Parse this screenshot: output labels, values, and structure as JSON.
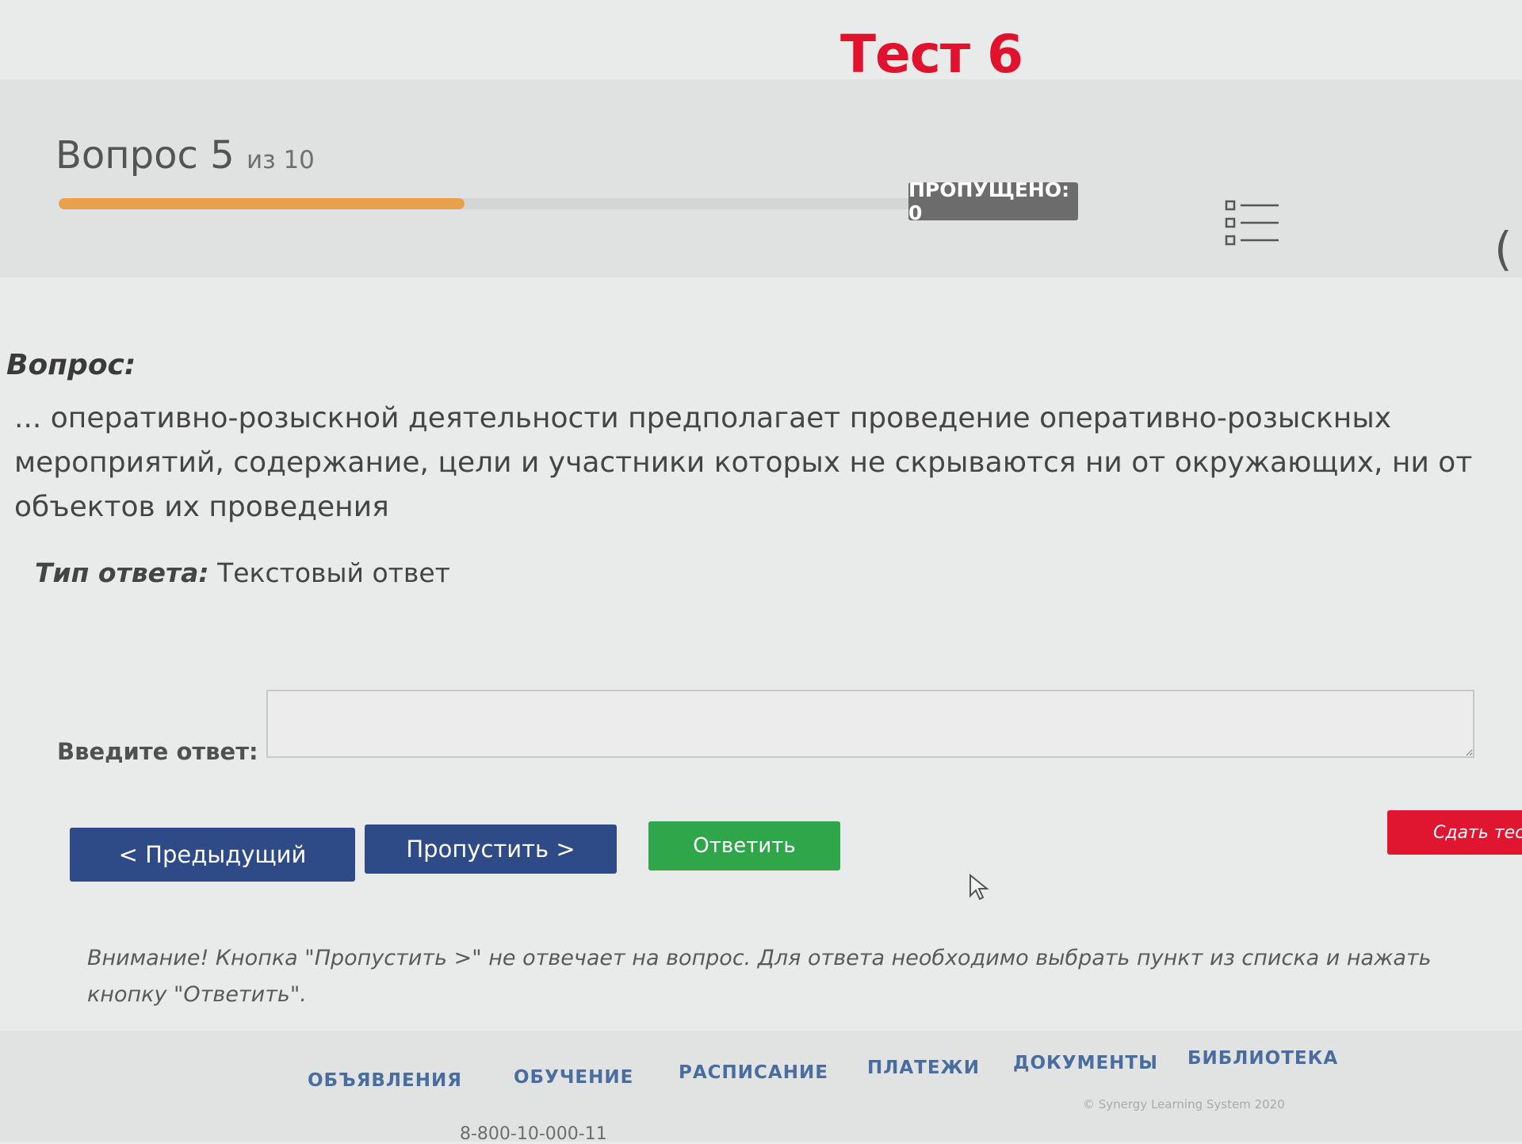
{
  "page": {
    "title": "Тест 6"
  },
  "progress": {
    "question_label": "Вопрос 5",
    "of_label": "из 10",
    "current": 5,
    "total": 10,
    "fill_fraction": 0.4,
    "skipped_label": "ПРОПУЩЕНО: 0"
  },
  "question": {
    "label": "Вопрос:",
    "text": "... оперативно-розыскной деятельности предполагает проведение оперативно-розыскных мероприятий, содержание, цели и участники которых не скрываются ни от окружающих, ни от объектов их проведения"
  },
  "answer_type": {
    "label": "Тип ответа:",
    "value": "Текстовый ответ"
  },
  "answer": {
    "label": "Введите ответ:",
    "value": ""
  },
  "buttons": {
    "prev": "< Предыдущий",
    "skip": "Пропустить >",
    "answer": "Ответить",
    "finish": "Сдать тест"
  },
  "warning": "Внимание! Кнопка \"Пропустить >\" не отвечает на вопрос. Для ответа необходимо выбрать пункт из списка и нажать кнопку \"Ответить\".",
  "footer": {
    "nav": [
      "ОБЪЯВЛЕНИЯ",
      "ОБУЧЕНИЕ",
      "РАСПИСАНИЕ",
      "ПЛАТЕЖИ",
      "ДОКУМЕНТЫ",
      "БИБЛИОТЕКА"
    ],
    "copyright": "© Synergy Learning System 2020",
    "phone": "8-800-10-000-11"
  },
  "icons": {
    "list": "question-list-icon",
    "cursor": "mouse-cursor-icon",
    "edge": "partial-icon"
  },
  "colors": {
    "title": "#e0122e",
    "progress": "#e8a14a",
    "nav_buttons": "#2e4a87",
    "answer_button": "#2fa64a",
    "finish_button": "#e0152f",
    "footer_links": "#4a6da0"
  }
}
